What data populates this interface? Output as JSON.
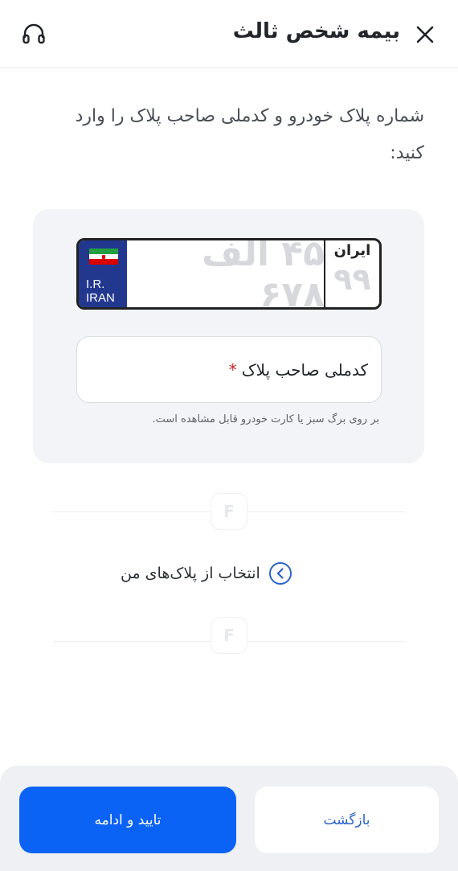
{
  "header": {
    "title": "بیمه شخص ثالث",
    "close_icon": "close-icon",
    "support_icon": "headset-icon"
  },
  "instruction": "شماره پلاک خودرو و کدملی صاحب پلاک را وارد کنید:",
  "plate": {
    "country_code_line1": "I.R.",
    "country_code_line2": "IRAN",
    "number_placeholder": "۴۵ الف ۶۷۸",
    "region_label": "ایران",
    "region_placeholder": "۹۹"
  },
  "national_id": {
    "label": "کدملی صاحب پلاک",
    "required_mark": "*",
    "hint": "بر روی برگ سبز یا کارت خودرو قابل مشاهده است."
  },
  "divider_logo": "F",
  "pick_plate": {
    "label": "انتخاب از پلاک‌های من",
    "icon": "chevron-left-circle-icon"
  },
  "footer": {
    "back_label": "بازگشت",
    "confirm_label": "تایید و ادامه"
  },
  "colors": {
    "primary": "#0b63f6",
    "plate_blue": "#22388f",
    "required": "#c62828",
    "link_blue": "#2a63c9"
  }
}
